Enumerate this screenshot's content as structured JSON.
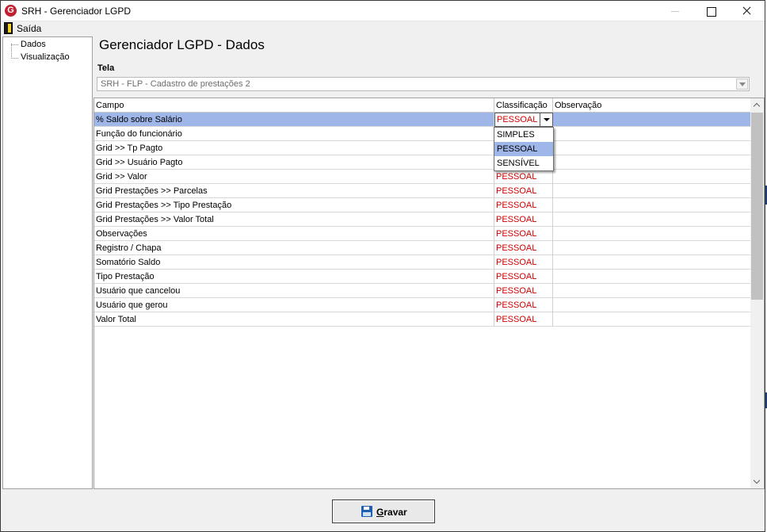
{
  "window": {
    "title": "SRH - Gerenciador LGPD",
    "app_icon_letter": "G"
  },
  "menu": {
    "exit_label": "Saída"
  },
  "tree": {
    "items": [
      {
        "label": "Dados"
      },
      {
        "label": "Visualização"
      }
    ]
  },
  "main": {
    "title": "Gerenciador LGPD - Dados",
    "tela_label": "Tela",
    "tela_value": "SRH - FLP - Cadastro de prestações 2"
  },
  "grid": {
    "headers": [
      "Campo",
      "Classificação",
      "Observação"
    ],
    "rows": [
      {
        "campo": "% Saldo sobre Salário",
        "classificacao": "PESSOAL",
        "observacao": ""
      },
      {
        "campo": "Função do funcionário",
        "classificacao": "",
        "observacao": ""
      },
      {
        "campo": "Grid >> Tp Pagto",
        "classificacao": "",
        "observacao": ""
      },
      {
        "campo": "Grid >> Usuário Pagto",
        "classificacao": "",
        "observacao": ""
      },
      {
        "campo": "Grid >> Valor",
        "classificacao": "PESSOAL",
        "observacao": ""
      },
      {
        "campo": "Grid Prestações >> Parcelas",
        "classificacao": "PESSOAL",
        "observacao": ""
      },
      {
        "campo": "Grid Prestações >> Tipo Prestação",
        "classificacao": "PESSOAL",
        "observacao": ""
      },
      {
        "campo": "Grid Prestações >> Valor Total",
        "classificacao": "PESSOAL",
        "observacao": ""
      },
      {
        "campo": "Observações",
        "classificacao": "PESSOAL",
        "observacao": ""
      },
      {
        "campo": "Registro / Chapa",
        "classificacao": "PESSOAL",
        "observacao": ""
      },
      {
        "campo": "Somatório Saldo",
        "classificacao": "PESSOAL",
        "observacao": ""
      },
      {
        "campo": "Tipo Prestação",
        "classificacao": "PESSOAL",
        "observacao": ""
      },
      {
        "campo": "Usuário que cancelou",
        "classificacao": "PESSOAL",
        "observacao": ""
      },
      {
        "campo": "Usuário que gerou",
        "classificacao": "PESSOAL",
        "observacao": ""
      },
      {
        "campo": "Valor Total",
        "classificacao": "PESSOAL",
        "observacao": ""
      }
    ],
    "dropdown_options": [
      "SIMPLES",
      "PESSOAL",
      "SENSÍVEL"
    ],
    "dropdown_highlighted": "PESSOAL"
  },
  "footer": {
    "save_label": "Gravar"
  },
  "colors": {
    "selection": "#9fb6e9",
    "classification_text": "#d10000",
    "app_icon": "#c0202f"
  }
}
